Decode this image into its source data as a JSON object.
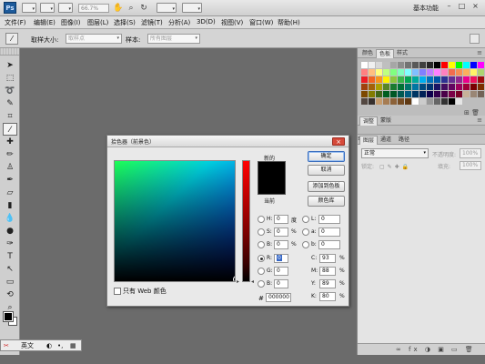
{
  "app": {
    "logo_text": "Ps",
    "zoom_value": "66.7%",
    "workspace_label": "基本功能",
    "window_min": "–",
    "window_max": "□",
    "window_close": "×"
  },
  "menu": [
    "文件(F)",
    "编辑(E)",
    "图像(I)",
    "图层(L)",
    "选择(S)",
    "滤镜(T)",
    "分析(A)",
    "3D(D)",
    "视图(V)",
    "窗口(W)",
    "帮助(H)"
  ],
  "options_bar": {
    "sample_size_label": "取样大小:",
    "sample_size_value": "取样点",
    "sample_label": "样本:",
    "sample_value": "所有图层"
  },
  "panels": {
    "top_tabs": [
      "颜色",
      "色板",
      "样式"
    ],
    "top_active": "色板",
    "mid_tabs": [
      "调整",
      "蒙版"
    ],
    "layers_tabs": [
      "图层",
      "通道",
      "路径"
    ],
    "blend_mode": "正常",
    "opacity_label": "不透明度:",
    "opacity_value": "100%",
    "lock_label": "锁定:",
    "fill_label": "填充:",
    "fill_value": "100%",
    "swatch_colors": [
      "#ffffff",
      "#f0f0f0",
      "#d8d8d8",
      "#bfbfbf",
      "#a6a6a6",
      "#8c8c8c",
      "#737373",
      "#595959",
      "#404040",
      "#262626",
      "#000000",
      "#ff0000",
      "#ffff00",
      "#00ff00",
      "#00ffff",
      "#0000ff",
      "#ff00ff",
      "#ff8080",
      "#ffbf80",
      "#ffff80",
      "#bfff80",
      "#80ff80",
      "#80ffbf",
      "#80ffff",
      "#80bfff",
      "#8080ff",
      "#bf80ff",
      "#ff80ff",
      "#ff80bf",
      "#f26c4f",
      "#f68e55",
      "#fbaf5d",
      "#fff467",
      "#acd372",
      "#ed1c24",
      "#f26522",
      "#f7941d",
      "#fff200",
      "#8dc63f",
      "#39b54a",
      "#00a651",
      "#00a99d",
      "#00aeef",
      "#0072bc",
      "#0054a6",
      "#2e3192",
      "#662d91",
      "#92278f",
      "#ec008c",
      "#ed145b",
      "#9e0b0f",
      "#a0410d",
      "#a36209",
      "#aba000",
      "#598527",
      "#1a7b30",
      "#007236",
      "#00746b",
      "#0076a3",
      "#004b80",
      "#003471",
      "#1b1464",
      "#440e62",
      "#630460",
      "#9e005d",
      "#9e0039",
      "#790000",
      "#7b2e00",
      "#7d4900",
      "#827b00",
      "#406618",
      "#005e20",
      "#005826",
      "#005952",
      "#005b7f",
      "#003663",
      "#002157",
      "#0d004c",
      "#32004b",
      "#4b0049",
      "#7b0046",
      "#7a0026",
      "#c7b299",
      "#998675",
      "#736357",
      "#534741",
      "#37302d",
      "#c69c6d",
      "#a67c52",
      "#8c6239",
      "#754c24",
      "#603913",
      "#ffffff",
      "#cccccc",
      "#999999",
      "#666666",
      "#333333",
      "#000000",
      "#e5e5e5"
    ],
    "swatch_tools": "⊞ 🗑"
  },
  "ime": {
    "lang": "英文",
    "moon": "◐",
    "dot": "•,",
    "grid": "▦"
  },
  "dialog": {
    "title": "拾色器（前景色）",
    "close_glyph": "×",
    "new_label": "新的",
    "current_label": "当前",
    "buttons": [
      "确定",
      "取消",
      "添加到色板",
      "颜色库"
    ],
    "web_only_label": "只有 Web 颜色",
    "hsb": [
      {
        "label": "H:",
        "value": "0",
        "unit": "度"
      },
      {
        "label": "S:",
        "value": "0",
        "unit": "%"
      },
      {
        "label": "B:",
        "value": "0",
        "unit": "%"
      }
    ],
    "rgb": [
      {
        "label": "R:",
        "value": "0",
        "unit": ""
      },
      {
        "label": "G:",
        "value": "0",
        "unit": ""
      },
      {
        "label": "B:",
        "value": "0",
        "unit": ""
      }
    ],
    "lab": [
      {
        "label": "L:",
        "value": "0"
      },
      {
        "label": "a:",
        "value": "0"
      },
      {
        "label": "b:",
        "value": "0"
      }
    ],
    "cmyk": [
      {
        "label": "C:",
        "value": "93",
        "unit": "%"
      },
      {
        "label": "M:",
        "value": "88",
        "unit": "%"
      },
      {
        "label": "Y:",
        "value": "89",
        "unit": "%"
      },
      {
        "label": "K:",
        "value": "80",
        "unit": "%"
      }
    ],
    "hex_label": "#",
    "hex_value": "000000",
    "preview_color": "#000000"
  }
}
